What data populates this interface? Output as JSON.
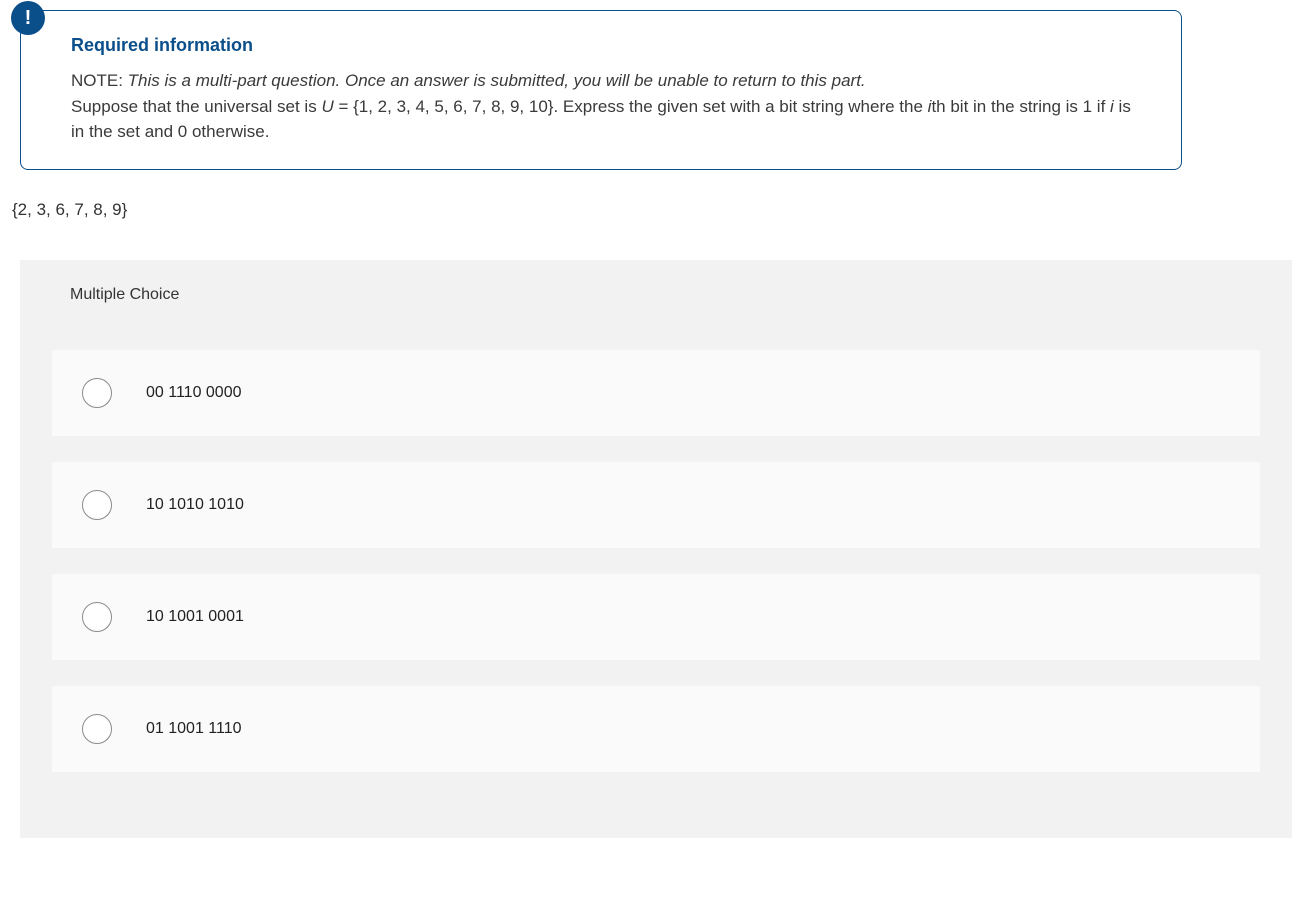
{
  "infoBox": {
    "title": "Required information",
    "noteLabel": "NOTE: ",
    "noteItalic": "This is a multi-part question. Once an answer is submitted, you will be unable to return to this part.",
    "body_pre": "Suppose that the universal set is ",
    "body_u": "U",
    "body_mid": " = {1, 2, 3, 4, 5, 6, 7, 8, 9, 10}. Express the given set with a bit string where the ",
    "body_i1": "i",
    "body_mid2": "th bit in the string is 1 if ",
    "body_i2": "i",
    "body_end": " is in the set and 0 otherwise."
  },
  "setText": "{2, 3, 6, 7, 8, 9}",
  "mc": {
    "header": "Multiple Choice",
    "options": [
      "00 1110 0000",
      "10 1010 1010",
      "10 1001 0001",
      "01 1001 1110"
    ]
  }
}
